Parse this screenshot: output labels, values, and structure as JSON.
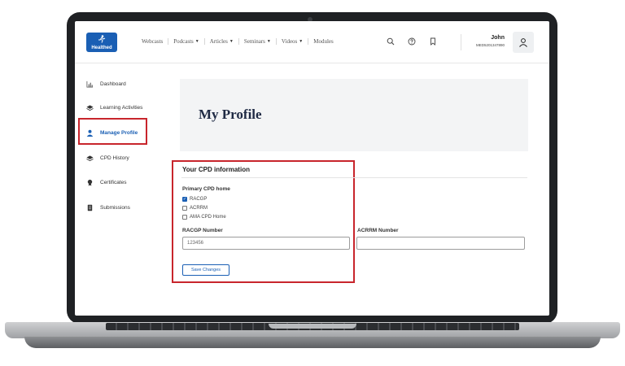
{
  "brand": {
    "logo_text": "Healthed",
    "color": "#1a5fb4"
  },
  "nav": {
    "items": [
      {
        "label": "Webcasts",
        "dropdown": false
      },
      {
        "label": "Podcasts",
        "dropdown": true
      },
      {
        "label": "Articles",
        "dropdown": true
      },
      {
        "label": "Seminars",
        "dropdown": true
      },
      {
        "label": "Videos",
        "dropdown": true
      },
      {
        "label": "Modules",
        "dropdown": false
      }
    ],
    "icons": [
      "search-icon",
      "help-icon",
      "bookmark-icon"
    ]
  },
  "user": {
    "name": "John",
    "id": "MED5201347890"
  },
  "sidebar": {
    "items": [
      {
        "label": "Dashboard",
        "icon": "chart-icon"
      },
      {
        "label": "Learning Activities",
        "icon": "layers-icon"
      },
      {
        "label": "Manage Profile",
        "icon": "user-icon",
        "active": true
      },
      {
        "label": "CPD History",
        "icon": "layers-icon"
      },
      {
        "label": "Certificates",
        "icon": "award-icon"
      },
      {
        "label": "Submissions",
        "icon": "document-icon"
      }
    ]
  },
  "page": {
    "title": "My Profile"
  },
  "cpd": {
    "section_title": "Your CPD information",
    "primary_label": "Primary CPD home",
    "options": [
      {
        "label": "RACGP",
        "checked": true
      },
      {
        "label": "ACRRM",
        "checked": false
      },
      {
        "label": "AMA CPD Home",
        "checked": false
      }
    ],
    "racgp_label": "RACGP Number",
    "racgp_value": "123456",
    "acrrm_label": "ACRRM Number",
    "acrrm_value": "",
    "save_label": "Save Changes"
  },
  "colors": {
    "highlight": "#c8252c",
    "accent": "#1a5fb4"
  }
}
